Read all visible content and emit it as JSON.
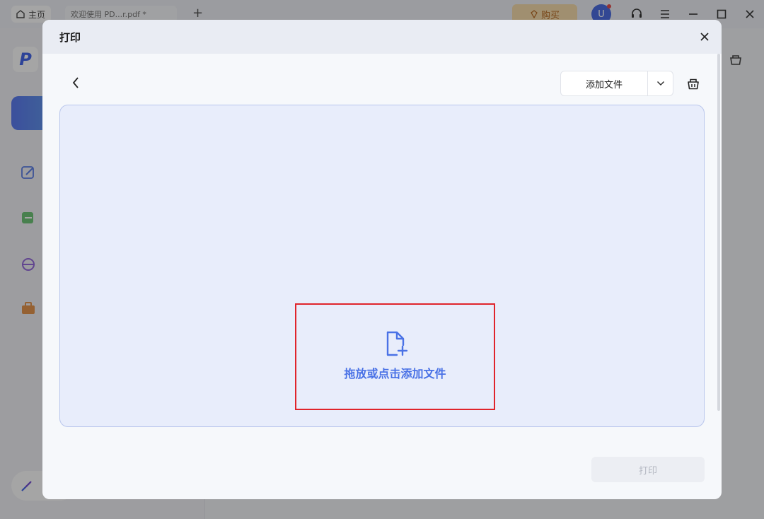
{
  "app": {
    "home_tab": "主页",
    "doc_tab": "欢迎使用 PD...r.pdf *",
    "add_tab": "+",
    "buy_label": "购买",
    "avatar_letter": "U",
    "logo_letter": "P"
  },
  "dialog": {
    "title": "打印",
    "add_file_label": "添加文件",
    "dropzone_label": "拖放或点击添加文件",
    "print_label": "打印"
  },
  "colors": {
    "accent": "#4a72e6",
    "highlight_border": "#e0242b",
    "dropzone_bg": "#e8edfb",
    "brand": "#3157e8"
  },
  "icons": {
    "back": "chevron-left-icon",
    "close": "close-icon",
    "dropdown": "chevron-down-icon",
    "clear": "trash-basket-icon",
    "dropzone": "file-add-icon"
  }
}
